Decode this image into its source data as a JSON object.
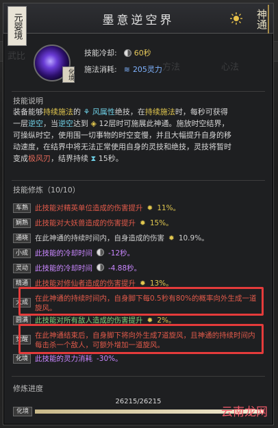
{
  "header": {
    "realm_tag": "元婴境",
    "title": "墨意逆空界",
    "shentong_mark": "神通"
  },
  "stats": {
    "cooldown_label": "技能冷却:",
    "cooldown_value": "60秒",
    "cost_label": "施法消耗:",
    "cost_value": "205灵力",
    "avatar_tag": "化境"
  },
  "background_tabs": [
    "武比",
    "方法",
    "心法"
  ],
  "description": {
    "section_title": "技能说明",
    "p1a": "装备能够",
    "p1b": "持续施法",
    "p1c": "的",
    "p1d": "风属性",
    "p1e": "绝技，在",
    "p1f": "持续施法",
    "p1g": "时，每秒可获得",
    "p2a": "一层",
    "p2b": "逆空",
    "p2c": "，当",
    "p2d": "逆空",
    "p2e": "达到",
    "p2f": "12层时可施展此神通。施放时空结界，",
    "p3": "可操纵时空，使用围一切事物的时空变慢，并且大幅提升自身的移",
    "p4": "动速度，在结界中将无法正常使用自身的灵技和绝技，灵技将暂时",
    "p5a": "变成",
    "p5b": "极风刃",
    "p5c": "，结界持续",
    "p5d": "15秒。"
  },
  "mods": {
    "section_title": "技能修炼（10/10）",
    "items": [
      {
        "tag": "车熟",
        "text": "此技能对精英单位造成的伤害提升",
        "extra": "11%。",
        "style": "red"
      },
      {
        "tag": "娴熟",
        "text": "此技能对大妖兽造成的伤害提升",
        "extra": "15%。",
        "style": "red"
      },
      {
        "tag": "通晓",
        "text": "在此神通的持续时间内，自身造成的伤害",
        "extra": "10.9%。",
        "style": "normal"
      },
      {
        "tag": "小成",
        "text": "此技能的冷却时间",
        "extra": "-12秒。",
        "style": "purple"
      },
      {
        "tag": "灵动",
        "text": "此技能的冷却时间",
        "extra": "-4.88秒。",
        "style": "purple"
      },
      {
        "tag": "精通",
        "text": "此技能对修仙者造成的伤害提升",
        "extra": "13%。",
        "style": "red"
      },
      {
        "tag": "大成",
        "text": "在此神通的持续时间内，自身脚下每0.5秒有80%的概率向外生成一道旋风。",
        "extra": "",
        "style": "red"
      },
      {
        "tag": "圆满",
        "text": "此技能对所有敌人造成的伤害提升",
        "extra": "2%。",
        "style": "green"
      },
      {
        "tag": "觉醒",
        "text": "在此神通结束后，自身脚下将向外生成7道旋风，且神通的持续时间内每击杀一个敌人，可额外增加一道旋风。",
        "extra": "",
        "style": "red"
      },
      {
        "tag": "化境",
        "text": "此技能的灵力消耗",
        "extra": "-30%。",
        "style": "purple"
      }
    ]
  },
  "progress": {
    "section_title": "修炼进度",
    "value_text": "26215/26215",
    "fraction": 1.0,
    "tag": "化境"
  },
  "watermark": "云南龙网"
}
